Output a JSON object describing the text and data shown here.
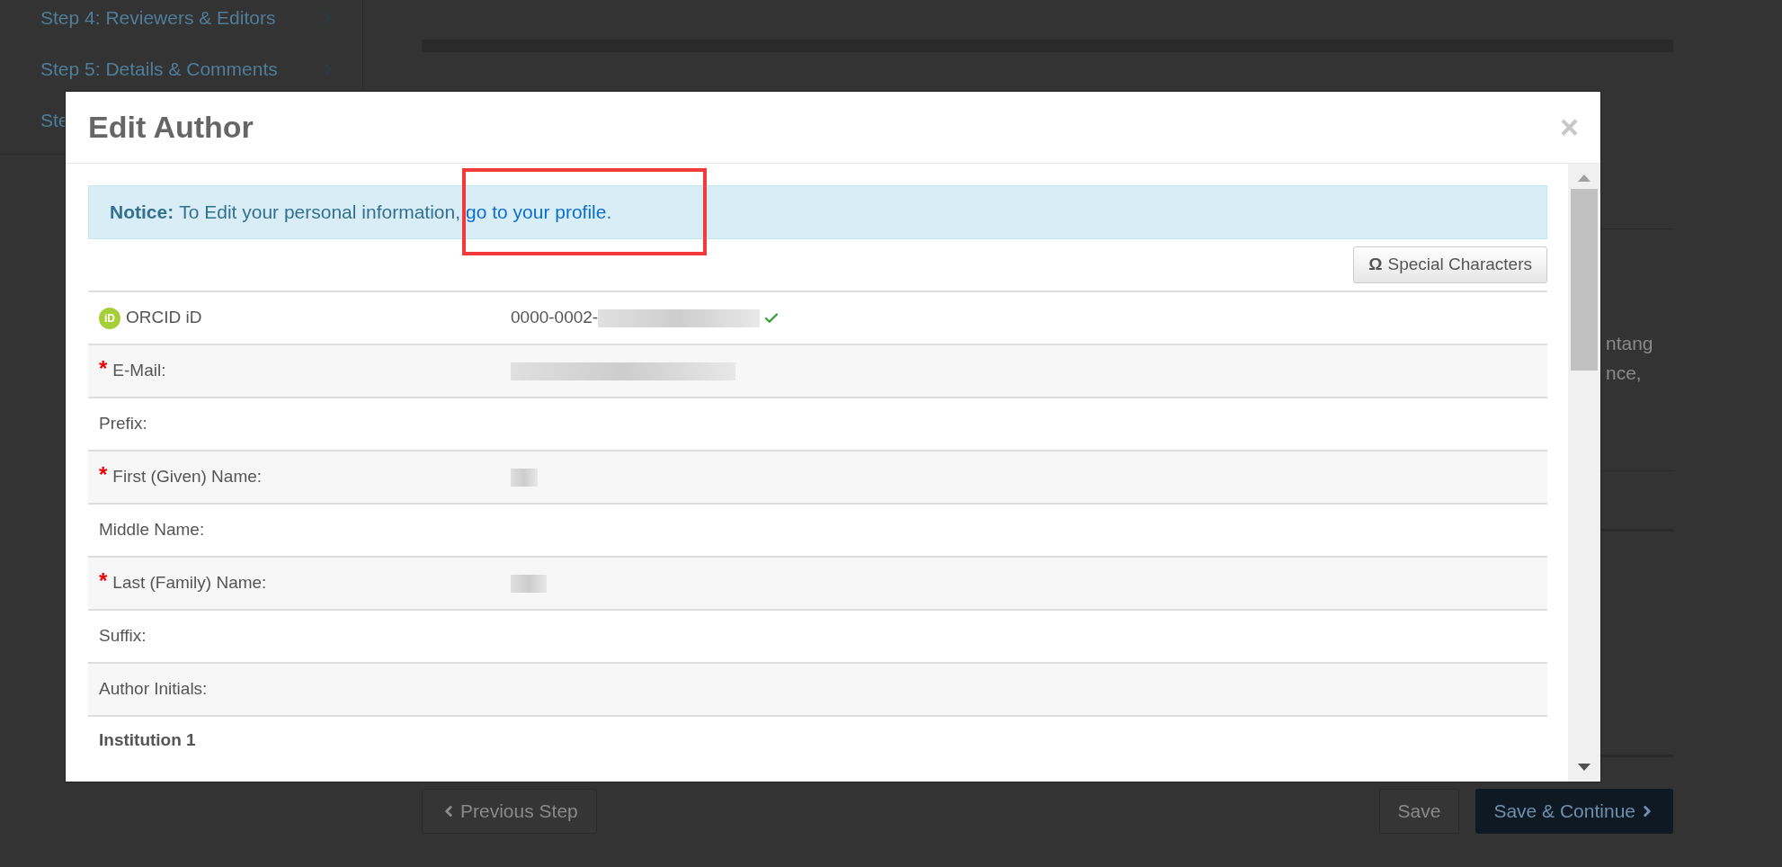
{
  "background": {
    "sidebar": {
      "items": [
        {
          "label": "Step 4: Reviewers & Editors"
        },
        {
          "label": "Step 5: Details & Comments"
        },
        {
          "label": "Ste"
        }
      ]
    },
    "text_fragments": [
      "ntang",
      "nce,"
    ],
    "footer": {
      "previous": "Previous Step",
      "save": "Save",
      "save_continue": "Save & Continue"
    }
  },
  "dialog": {
    "title": "Edit Author",
    "close": "×",
    "notice": {
      "label": "Notice:",
      "text": "To Edit your personal information,",
      "link": "go to your profile",
      "after": "."
    },
    "special_characters": {
      "symbol": "Ω",
      "label": "Special Characters"
    },
    "required_mark": "*",
    "rows": [
      {
        "label": "ORCID iD",
        "badge": "iD",
        "required": false,
        "value": "0000-0002-",
        "redacted": true,
        "verified": true
      },
      {
        "label": "E-Mail:",
        "required": true,
        "redacted": true,
        "verified": false
      },
      {
        "label": "Prefix:",
        "required": false,
        "redacted": false,
        "verified": false
      },
      {
        "label": "First (Given) Name:",
        "required": true,
        "redacted": true,
        "verified": false
      },
      {
        "label": "Middle Name:",
        "required": false,
        "redacted": false,
        "verified": false
      },
      {
        "label": "Last (Family) Name:",
        "required": true,
        "redacted": true,
        "verified": false
      },
      {
        "label": "Suffix:",
        "required": false,
        "redacted": false,
        "verified": false
      },
      {
        "label": "Author Initials:",
        "required": false,
        "redacted": false,
        "verified": false
      }
    ],
    "section": "Institution 1"
  }
}
